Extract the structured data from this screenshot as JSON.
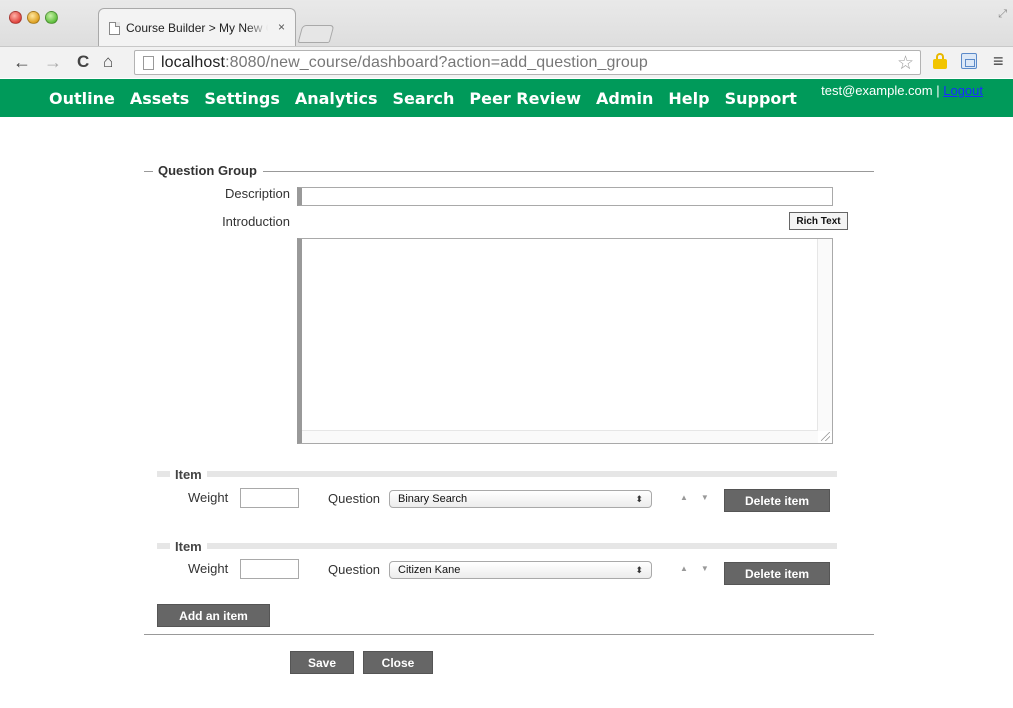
{
  "browser": {
    "tab_title": "Course Builder > My New Course",
    "tab_close": "×",
    "url_host": "localhost",
    "url_rest": ":8080/new_course/dashboard?action=add_question_group"
  },
  "nav": {
    "items": [
      "Outline",
      "Assets",
      "Settings",
      "Analytics",
      "Search",
      "Peer Review",
      "Admin",
      "Help",
      "Support"
    ],
    "user_email": "test@example.com",
    "separator": " | ",
    "logout": "Logout"
  },
  "form": {
    "legend": "Question Group",
    "description_label": "Description",
    "description_value": "",
    "introduction_label": "Introduction",
    "rich_text_button": "Rich Text",
    "introduction_value": "",
    "items": [
      {
        "legend": "Item",
        "weight_label": "Weight",
        "weight_value": "",
        "question_label": "Question",
        "question_value": "Binary Search",
        "delete_label": "Delete item"
      },
      {
        "legend": "Item",
        "weight_label": "Weight",
        "weight_value": "",
        "question_label": "Question",
        "question_value": "Citizen Kane",
        "delete_label": "Delete item"
      }
    ],
    "add_item_label": "Add an item",
    "save_label": "Save",
    "close_label": "Close"
  },
  "icons": {
    "back": "back-arrow-icon",
    "forward": "forward-arrow-icon",
    "reload": "reload-icon",
    "home": "home-icon",
    "bookmark": "star-icon",
    "menu": "hamburger-menu-icon"
  },
  "colors": {
    "nav_bg": "#009a5a",
    "button_bg": "#666666",
    "logout_link": "#1a2bff"
  }
}
